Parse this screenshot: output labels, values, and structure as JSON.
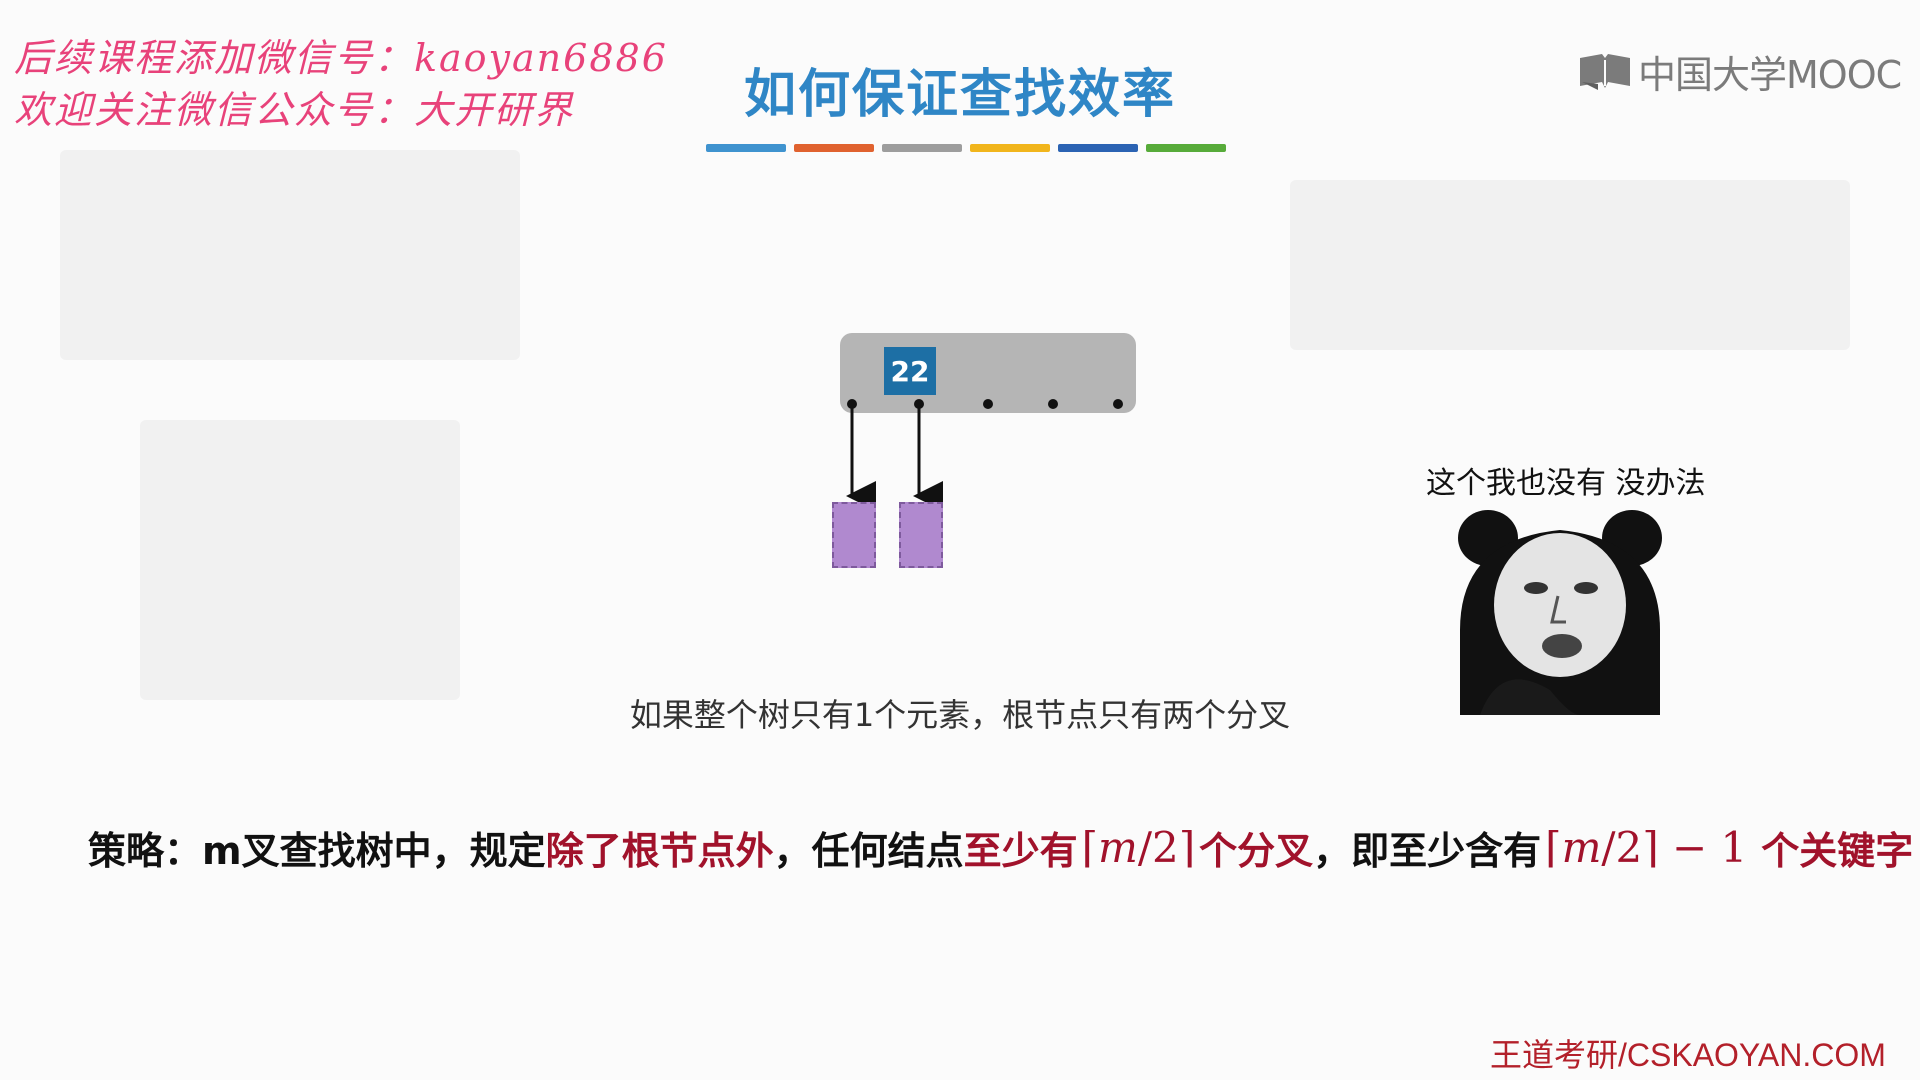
{
  "watermark": {
    "line1": "后续课程添加微信号：kaoyan6886",
    "line2": "欢迎关注微信公众号：大开研界"
  },
  "logo": {
    "text": "中国大学MOOC",
    "icon": "open-book-icon"
  },
  "slide": {
    "title": "如何保证查找效率",
    "title_bar_colors": [
      "#3f93cf",
      "#e0622f",
      "#9d9d9d",
      "#f1b51c",
      "#2b63b3",
      "#57ab3a"
    ]
  },
  "diagram": {
    "key": "22",
    "node_color": "#b5b5b5",
    "key_color": "#1d6fa5",
    "leaf_color": "#b089cf"
  },
  "caption": "如果整个树只有1个元素，根节点只有两个分叉",
  "meme": {
    "caption": "这个我也没有 没办法",
    "icon": "panda-meme-icon"
  },
  "strategy": {
    "part1": "策略：m叉查找树中，规定",
    "part2_red": "除了根节点外",
    "part3": "，任何结点",
    "part4_red": "至少有",
    "math1_m": "m",
    "math1_rest": "/2",
    "part5_red": "个分叉",
    "part6": "，即至少含有",
    "math2_m": "m",
    "math2_rest": "/2",
    "math2_tail": " − 1",
    "part7_red": "个关键字"
  },
  "footer": "王道考研/CSKAOYAN.COM"
}
